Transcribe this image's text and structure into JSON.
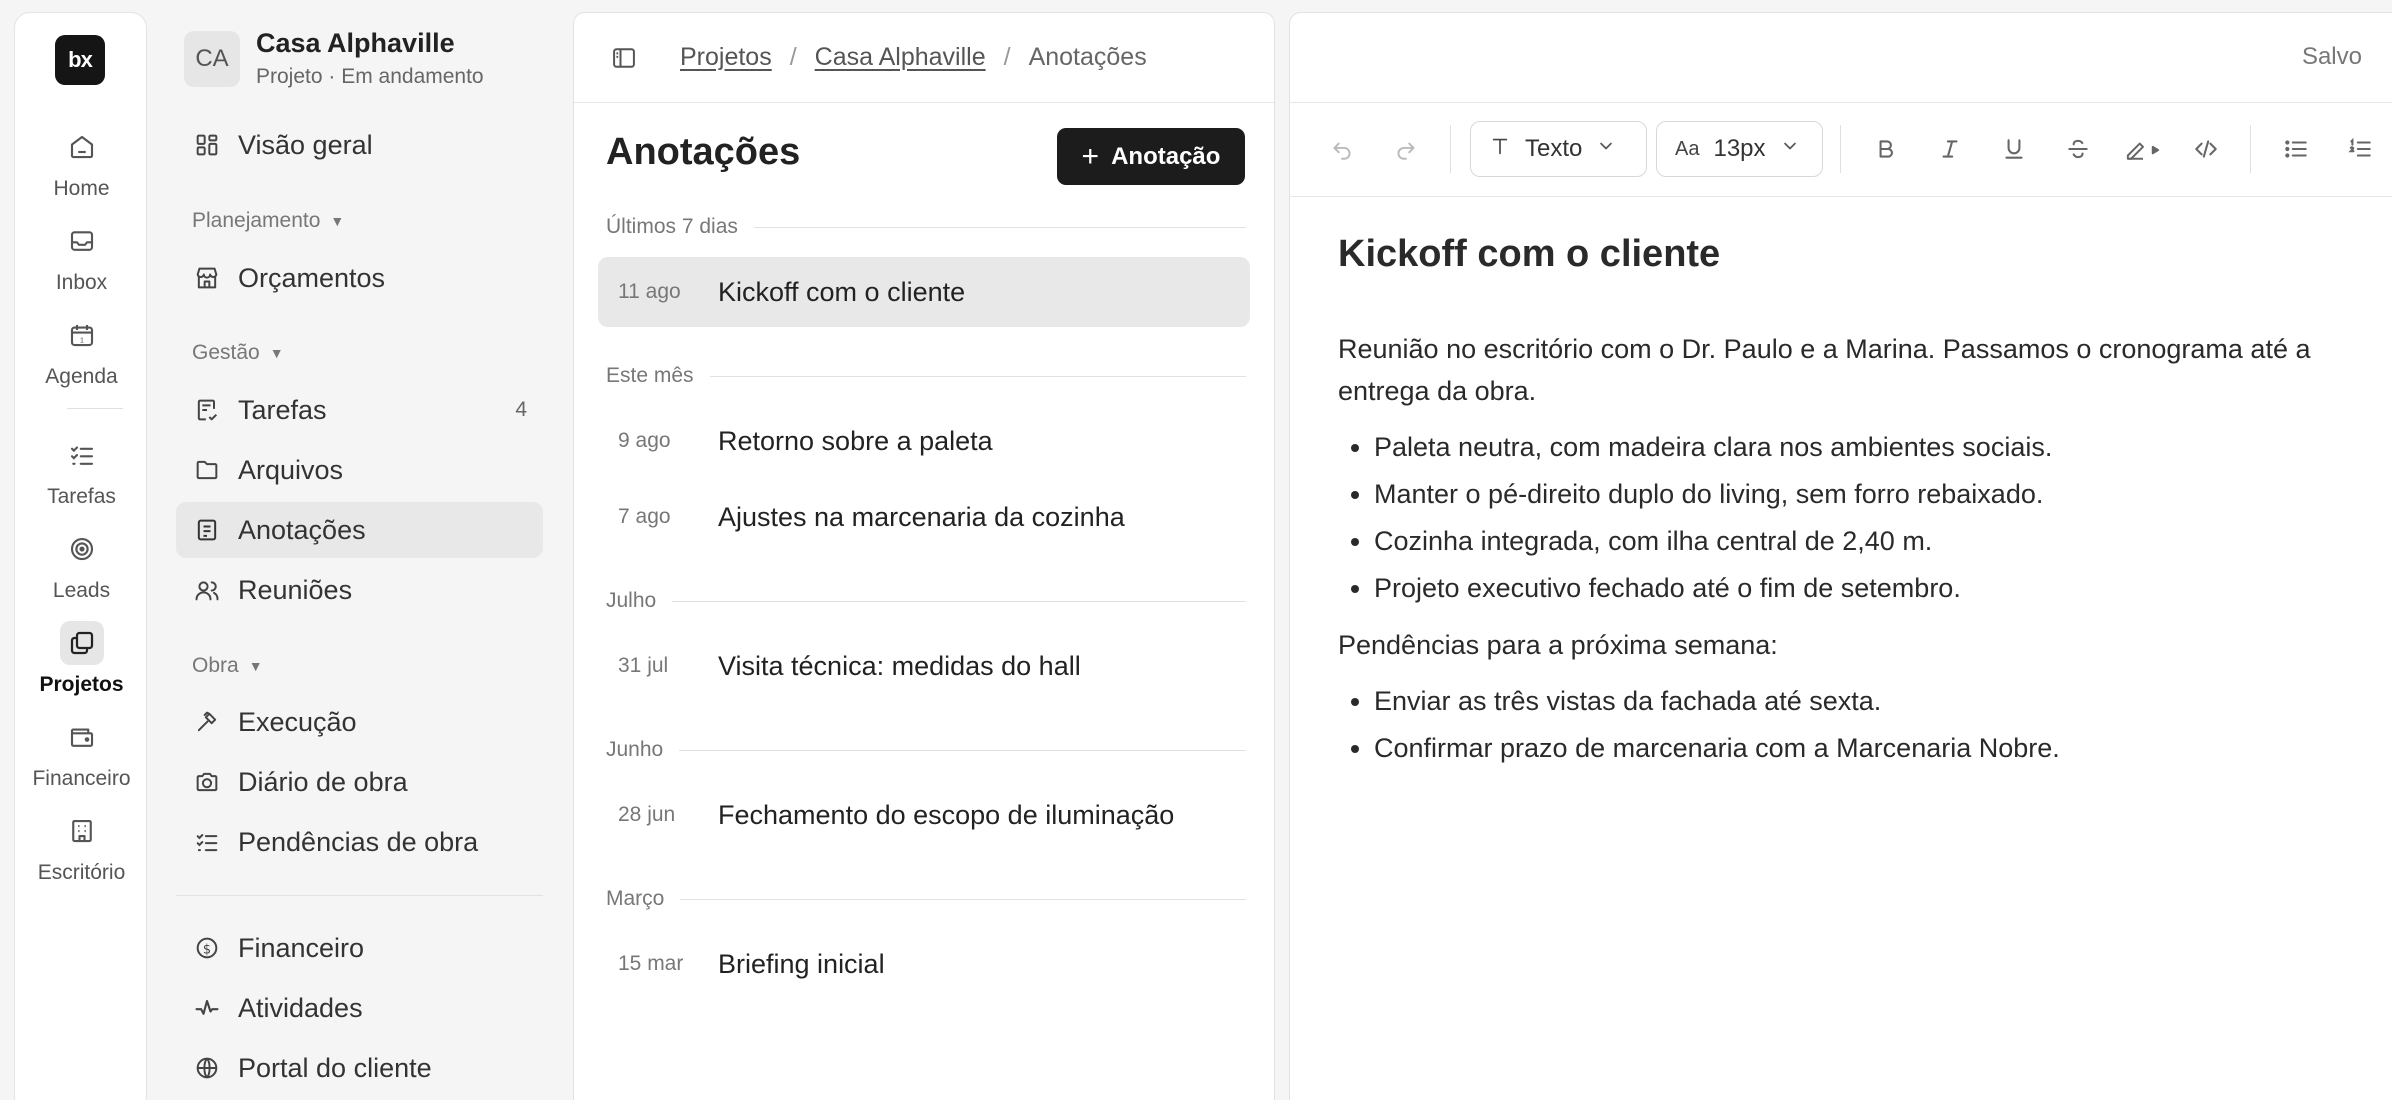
{
  "rail": {
    "logo": "bx",
    "items": [
      {
        "label": "Home",
        "icon": "home-icon"
      },
      {
        "label": "Inbox",
        "icon": "inbox-icon"
      },
      {
        "label": "Agenda",
        "icon": "calendar-icon"
      },
      {
        "label": "Tarefas",
        "icon": "tasks-icon"
      },
      {
        "label": "Leads",
        "icon": "target-icon"
      },
      {
        "label": "Projetos",
        "icon": "projects-icon"
      },
      {
        "label": "Financeiro",
        "icon": "wallet-icon"
      },
      {
        "label": "Escritório",
        "icon": "building-icon"
      }
    ]
  },
  "project": {
    "initials": "CA",
    "name": "Casa Alphaville",
    "subtitle": "Projeto · Em andamento"
  },
  "sidebar": {
    "overview": "Visão geral",
    "groups": {
      "planejamento": "Planejamento",
      "gestao": "Gestão",
      "obra": "Obra"
    },
    "items": {
      "orcamentos": "Orçamentos",
      "tarefas": "Tarefas",
      "tarefas_count": "4",
      "arquivos": "Arquivos",
      "anotacoes": "Anotações",
      "reunioes": "Reuniões",
      "execucao": "Execução",
      "diario": "Diário de obra",
      "pendencias": "Pendências de obra",
      "financeiro": "Financeiro",
      "atividades": "Atividades",
      "portal": "Portal do cliente"
    }
  },
  "breadcrumb": [
    "Projetos",
    "Casa Alphaville",
    "Anotações"
  ],
  "notes_panel": {
    "title": "Anotações",
    "add_button": "Anotação",
    "sections": {
      "last7": "Últimos 7 dias",
      "month": "Este mês",
      "julho": "Julho",
      "junho": "Junho",
      "marco": "Março"
    },
    "notes": [
      {
        "date": "11 ago",
        "title": "Kickoff com o cliente"
      },
      {
        "date": "9 ago",
        "title": "Retorno sobre a paleta"
      },
      {
        "date": "7 ago",
        "title": "Ajustes na marcenaria da cozinha"
      },
      {
        "date": "31 jul",
        "title": "Visita técnica: medidas do hall"
      },
      {
        "date": "28 jun",
        "title": "Fechamento do escopo de iluminação"
      },
      {
        "date": "15 mar",
        "title": "Briefing inicial"
      }
    ]
  },
  "editor": {
    "status": "Salvo",
    "toolbar": {
      "style": "Texto",
      "size": "13px",
      "size_glyph": "Aa"
    },
    "title": "Kickoff com o cliente",
    "intro": "Reunião no escritório com o Dr. Paulo e a Marina. Passamos o cronograma até a entrega da obra.",
    "bullets1": [
      "Paleta neutra, com madeira clara nos ambientes sociais.",
      "Manter o pé-direito duplo do living, sem forro rebaixado.",
      "Cozinha integrada, com ilha central de 2,40 m.",
      "Projeto executivo fechado até o fim de setembro."
    ],
    "pending_heading": "Pendências para a próxima semana:",
    "bullets2": [
      "Enviar as três vistas da fachada até sexta.",
      "Confirmar prazo de marcenaria com a Marcenaria Nobre."
    ]
  }
}
